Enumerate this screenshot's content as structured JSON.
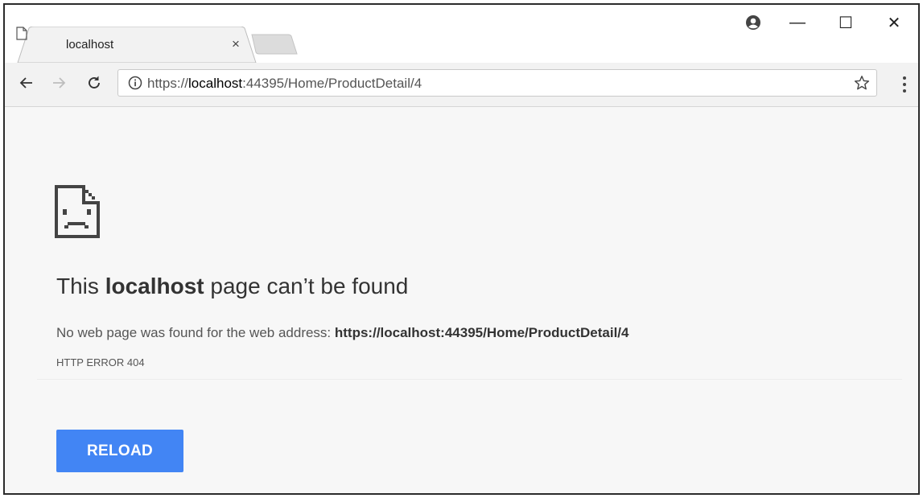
{
  "browser": {
    "tab": {
      "title": "localhost",
      "close_glyph": "×",
      "icon": "page-icon"
    },
    "new_tab": {
      "icon": "new-tab-icon"
    },
    "window_controls": {
      "profile_icon": "profile-icon",
      "minimize_glyph": "—",
      "maximize_glyph": "☐",
      "close_glyph": "✕"
    },
    "toolbar": {
      "back_icon": "back-arrow-icon",
      "forward_icon": "forward-arrow-icon",
      "reload_icon": "reload-icon",
      "address": {
        "scheme": "https://",
        "host": "localhost",
        "rest": ":44395/Home/ProductDetail/4",
        "icon": "info-icon"
      },
      "bookmark_icon": "star-icon",
      "menu_icon": "kebab-menu-icon"
    }
  },
  "page": {
    "icon": "sad-page-icon",
    "title": {
      "prefix": "This ",
      "host": "localhost",
      "suffix": " page can’t be found"
    },
    "description": {
      "text": "No web page was found for the web address: ",
      "url": "https://localhost:44395/Home/ProductDetail/4"
    },
    "error_code": "HTTP ERROR 404",
    "reload_label": "RELOAD"
  },
  "colors": {
    "reload_button": "#4285f4",
    "page_background": "#f7f7f7",
    "toolbar_background": "#f2f2f2"
  }
}
